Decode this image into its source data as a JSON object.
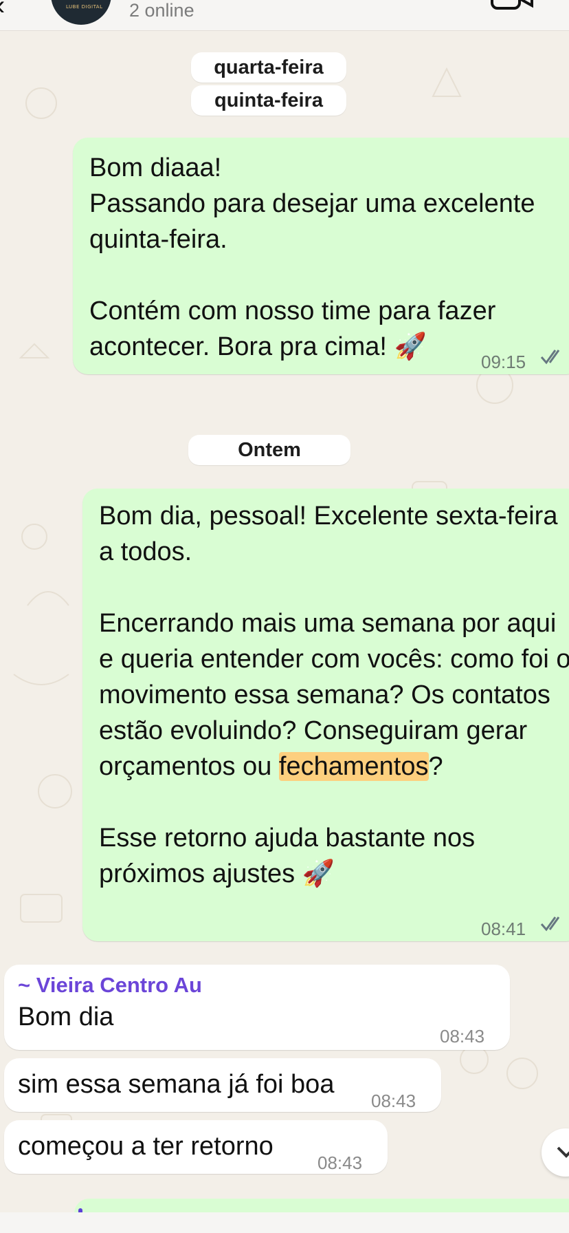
{
  "header": {
    "status": "2 online",
    "avatar_text": "LUBE DIGITAL"
  },
  "dates": [
    "quarta-feira",
    "quinta-feira",
    "Ontem"
  ],
  "messages": [
    {
      "direction": "out",
      "text": "Bom diaaa!\nPassando para desejar uma excelente quinta-feira.\n\nContém com nosso time para fazer acontecer. Bora pra cima! 🚀",
      "time": "09:15",
      "read": true
    },
    {
      "direction": "out",
      "text_before": "Bom dia, pessoal! Excelente sexta-feira a todos.\n\nEncerrando mais uma semana por aqui e queria entender com vocês: como foi o movimento essa semana? Os contatos estão evoluindo? Conseguiram gerar orçamentos ou ",
      "highlight": "fechamentos",
      "text_after": "?\n\nEsse retorno ajuda bastante nos próximos ajustes 🚀",
      "time": "08:41",
      "read": true
    },
    {
      "direction": "in",
      "sender": "~ Vieira Centro Au",
      "text": "Bom dia",
      "time": "08:43"
    },
    {
      "direction": "in",
      "text": "sim essa semana já foi boa",
      "time": "08:43"
    },
    {
      "direction": "in",
      "text": "começou a ter retorno",
      "time": "08:43"
    }
  ],
  "colors": {
    "outgoing_bubble": "#d9fdd3",
    "incoming_bubble": "#ffffff",
    "sender_name": "#6b45d8",
    "highlight": "#fdcf7e",
    "read_ticks": "#667781"
  }
}
